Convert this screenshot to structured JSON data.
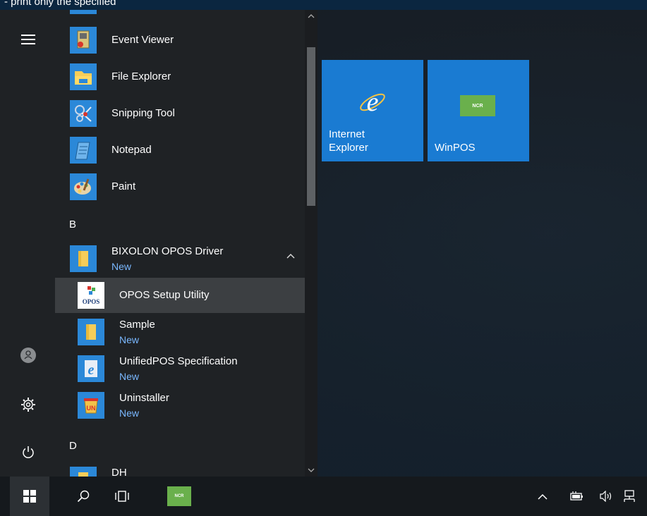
{
  "topband": {
    "text": "- print only the specified"
  },
  "applist": {
    "items_top": [
      {
        "label": "Event Viewer",
        "icon": "event-viewer-icon"
      },
      {
        "label": "File Explorer",
        "icon": "folder-icon"
      },
      {
        "label": "Snipping Tool",
        "icon": "scissors-icon"
      },
      {
        "label": "Notepad",
        "icon": "notepad-icon"
      },
      {
        "label": "Paint",
        "icon": "paint-palette-icon"
      }
    ],
    "letter_b": "B",
    "group": {
      "label": "BIXOLON OPOS Driver",
      "badge": "New",
      "expanded": true
    },
    "sub_items": [
      {
        "label": "OPOS Setup Utility",
        "badge": "",
        "icon": "opos-icon"
      },
      {
        "label": "Sample",
        "badge": "New",
        "icon": "folder-icon"
      },
      {
        "label": "UnifiedPOS Specification",
        "badge": "New",
        "icon": "ie-document-icon"
      },
      {
        "label": "Uninstaller",
        "badge": "New",
        "icon": "uninstaller-icon"
      }
    ],
    "letter_d": "D",
    "partial_item": {
      "label": "DH"
    }
  },
  "tiles": [
    {
      "line1": "Internet",
      "line2": "Explorer",
      "icon": "internet-explorer-icon",
      "color": "#1a7bd2"
    },
    {
      "line1": "WinPOS",
      "line2": "",
      "icon": "ncr-logo-icon",
      "color": "#1a7bd2"
    }
  ],
  "ncr_logo_text": "NCR",
  "colors": {
    "accent": "#2b88d8",
    "new_badge": "#7ab8ff",
    "tile": "#1a7bd2",
    "ncr_green": "#6ab04c"
  }
}
